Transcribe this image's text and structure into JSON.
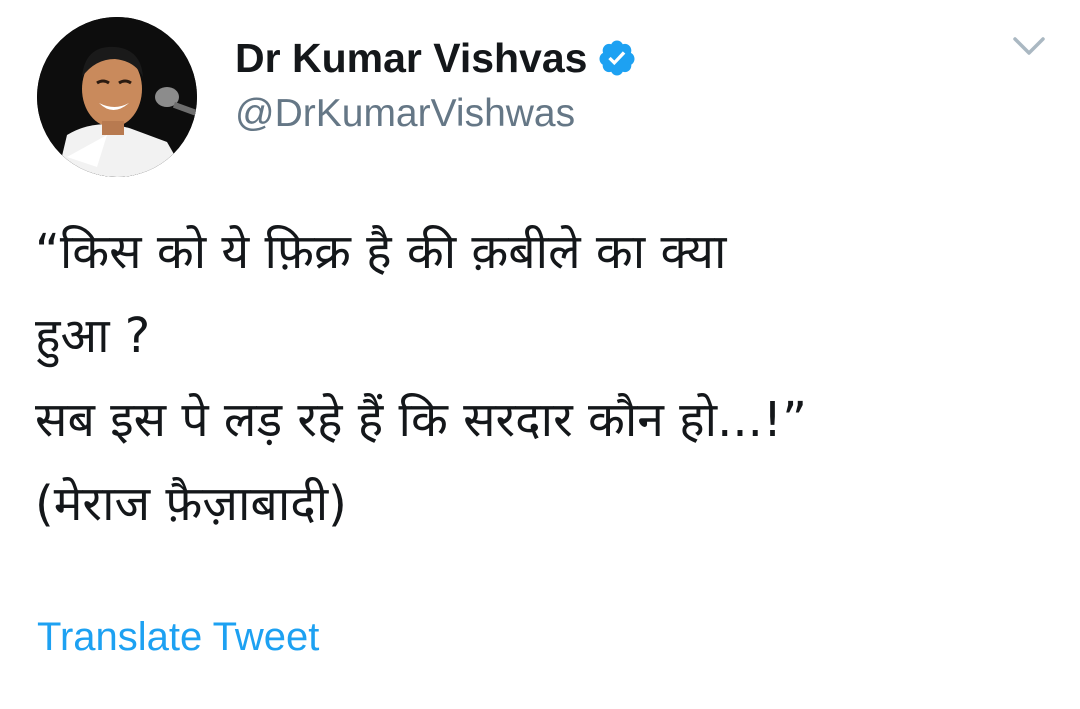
{
  "author": {
    "display_name": "Dr Kumar Vishvas",
    "handle": "@DrKumarVishwas",
    "verified": true
  },
  "tweet": {
    "lines": [
      "“किस को ये फ़िक्र है की क़बीले का क्या",
      "हुआ ?",
      "सब इस पे लड़ रहे हैं कि सरदार कौन हो...!”",
      "(मेराज फ़ैज़ाबादी)"
    ],
    "translate_label": "Translate Tweet"
  },
  "icons": {
    "verified": "verified-badge-icon",
    "menu": "chevron-down-icon"
  },
  "colors": {
    "accent": "#1da1f2",
    "text": "#14171a",
    "secondary": "#657786",
    "caret": "#aab8c2"
  }
}
